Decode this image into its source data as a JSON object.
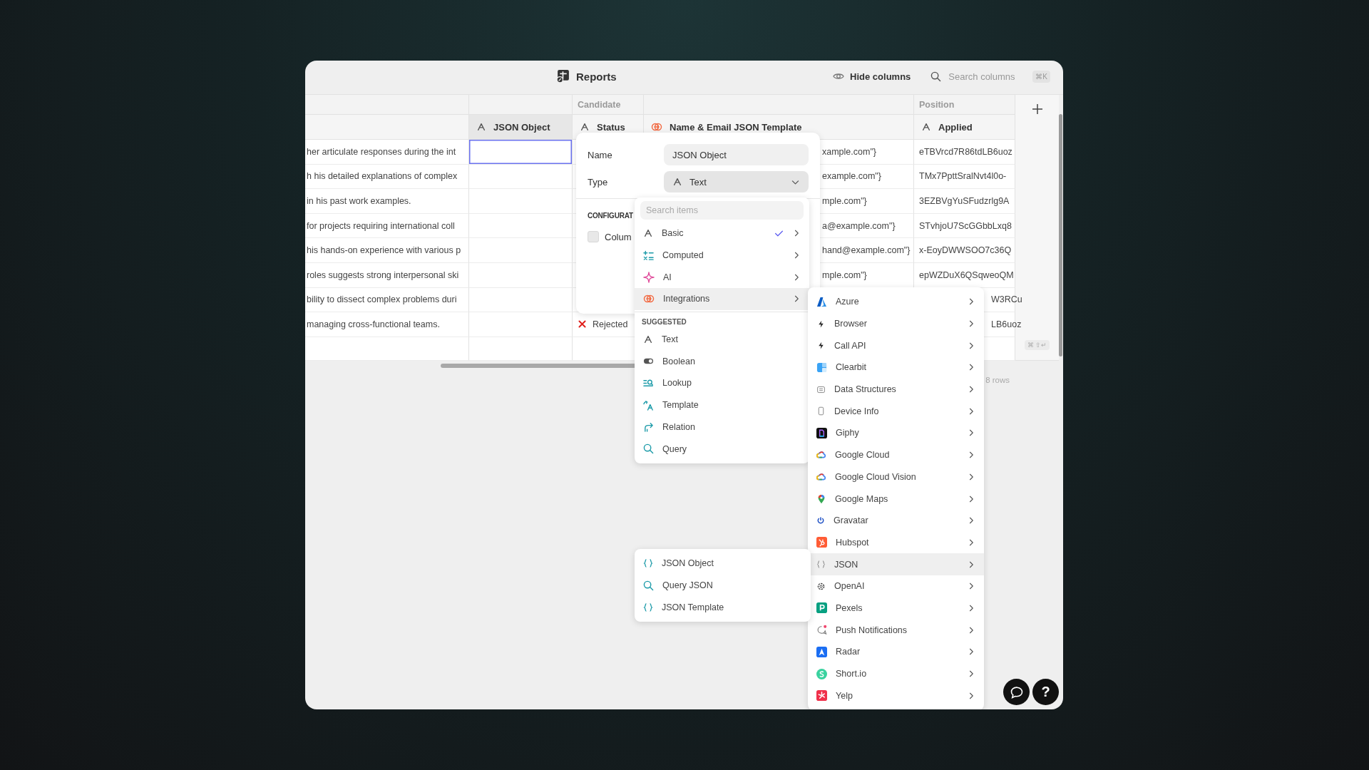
{
  "window": {
    "title": "Reports"
  },
  "toolbar": {
    "hide_columns": "Hide columns",
    "search": {
      "placeholder": "Search columns",
      "shortcut": "⌘K"
    }
  },
  "table": {
    "columns": [
      {
        "selected": false
      },
      {
        "kind": "text",
        "label": "JSON Object",
        "selected": true
      },
      {
        "kind": "text",
        "label": "Status",
        "group": "Candidate",
        "selected": false
      },
      {
        "kind": "integration",
        "label": "Name & Email JSON Template",
        "selected": false
      },
      {
        "kind": "text",
        "label": "Applied",
        "group": "Position",
        "selected": false
      }
    ],
    "rows": [
      {
        "excerpt": "her articulate responses during the int",
        "name_email": "xample.com\"}",
        "applied": "eTBVrcd7R86tdLB6uoz",
        "selected": true
      },
      {
        "excerpt": "h his detailed explanations of complex",
        "name_email": "example.com\"}",
        "applied": "TMx7PpttSralNvt4l0o-",
        "selected": false
      },
      {
        "excerpt": "in his past work examples.",
        "name_email": "mple.com\"}",
        "applied": "3EZBVgYuSFudzrlg9A",
        "selected": false
      },
      {
        "excerpt": "for projects requiring international coll",
        "name_email": "a@example.com\"}",
        "applied": "STvhjoU7ScGGbbLxq8",
        "selected": false
      },
      {
        "excerpt": "his hands-on experience with various p",
        "name_email": "hand@example.com\"}",
        "applied": "x-EoyDWWSOO7c36Q",
        "selected": false
      },
      {
        "excerpt": "roles suggests strong interpersonal ski",
        "name_email": "mple.com\"}",
        "applied": "epWZDuX6QSqweoQM",
        "selected": false
      },
      {
        "excerpt": "bility to dissect complex problems duri",
        "applied": "W3RCu",
        "selected": false
      },
      {
        "excerpt": "managing cross-functional teams.",
        "status": {
          "kind": "rejected",
          "label": "Rejected"
        },
        "applied": "LB6uoz",
        "selected": false
      }
    ],
    "row_count": "8 rows",
    "shortcut": "⌘ ⇧↵"
  },
  "column_editor": {
    "name_label": "Name",
    "name_value": "JSON Object",
    "type_label": "Type",
    "type_value": "Text",
    "section": "CONFIGURAT",
    "checkbox": {
      "label": "Colum",
      "checked": false
    }
  },
  "type_menu": {
    "search": {
      "placeholder": "Search items"
    },
    "items": [
      {
        "kind": "text",
        "label": "Basic",
        "submenu": true,
        "checked": true,
        "selected": false
      },
      {
        "kind": "computed",
        "label": "Computed",
        "submenu": true,
        "checked": false,
        "selected": false
      },
      {
        "kind": "ai",
        "label": "AI",
        "submenu": true,
        "checked": false,
        "selected": false
      },
      {
        "kind": "integrations",
        "label": "Integrations",
        "submenu": true,
        "checked": false,
        "selected": true
      }
    ],
    "suggested_title": "SUGGESTED",
    "suggested": [
      {
        "kind": "text",
        "label": "Text"
      },
      {
        "kind": "boolean",
        "label": "Boolean"
      },
      {
        "kind": "lookup",
        "label": "Lookup"
      },
      {
        "kind": "template",
        "label": "Template"
      },
      {
        "kind": "relation",
        "label": "Relation"
      },
      {
        "kind": "query",
        "label": "Query"
      }
    ]
  },
  "integrations_menu": {
    "items": [
      {
        "kind": "azure",
        "label": "Azure",
        "selected": false
      },
      {
        "kind": "bolt",
        "label": "Browser",
        "selected": false
      },
      {
        "kind": "bolt",
        "label": "Call API",
        "selected": false
      },
      {
        "kind": "clearbit",
        "label": "Clearbit",
        "selected": false
      },
      {
        "kind": "datastruct",
        "label": "Data Structures",
        "selected": false
      },
      {
        "kind": "device",
        "label": "Device Info",
        "selected": false
      },
      {
        "kind": "giphy",
        "label": "Giphy",
        "selected": false
      },
      {
        "kind": "gcloud",
        "label": "Google Cloud",
        "selected": false
      },
      {
        "kind": "gcloud",
        "label": "Google Cloud Vision",
        "selected": false
      },
      {
        "kind": "maps",
        "label": "Google Maps",
        "selected": false
      },
      {
        "kind": "gravatar",
        "label": "Gravatar",
        "selected": false
      },
      {
        "kind": "hubspot",
        "label": "Hubspot",
        "selected": false
      },
      {
        "kind": "json",
        "label": "JSON",
        "selected": true
      },
      {
        "kind": "openai",
        "label": "OpenAI",
        "selected": false
      },
      {
        "kind": "pexels",
        "label": "Pexels",
        "selected": false
      },
      {
        "kind": "push",
        "label": "Push Notifications",
        "selected": false
      },
      {
        "kind": "radar",
        "label": "Radar",
        "selected": false
      },
      {
        "kind": "shortio",
        "label": "Short.io",
        "selected": false
      },
      {
        "kind": "yelp",
        "label": "Yelp",
        "selected": false
      }
    ]
  },
  "json_menu": {
    "items": [
      {
        "kind": "braces",
        "label": "JSON Object"
      },
      {
        "kind": "query",
        "label": "Query JSON"
      },
      {
        "kind": "braces",
        "label": "JSON Template"
      }
    ]
  },
  "help": {
    "label": "?"
  }
}
